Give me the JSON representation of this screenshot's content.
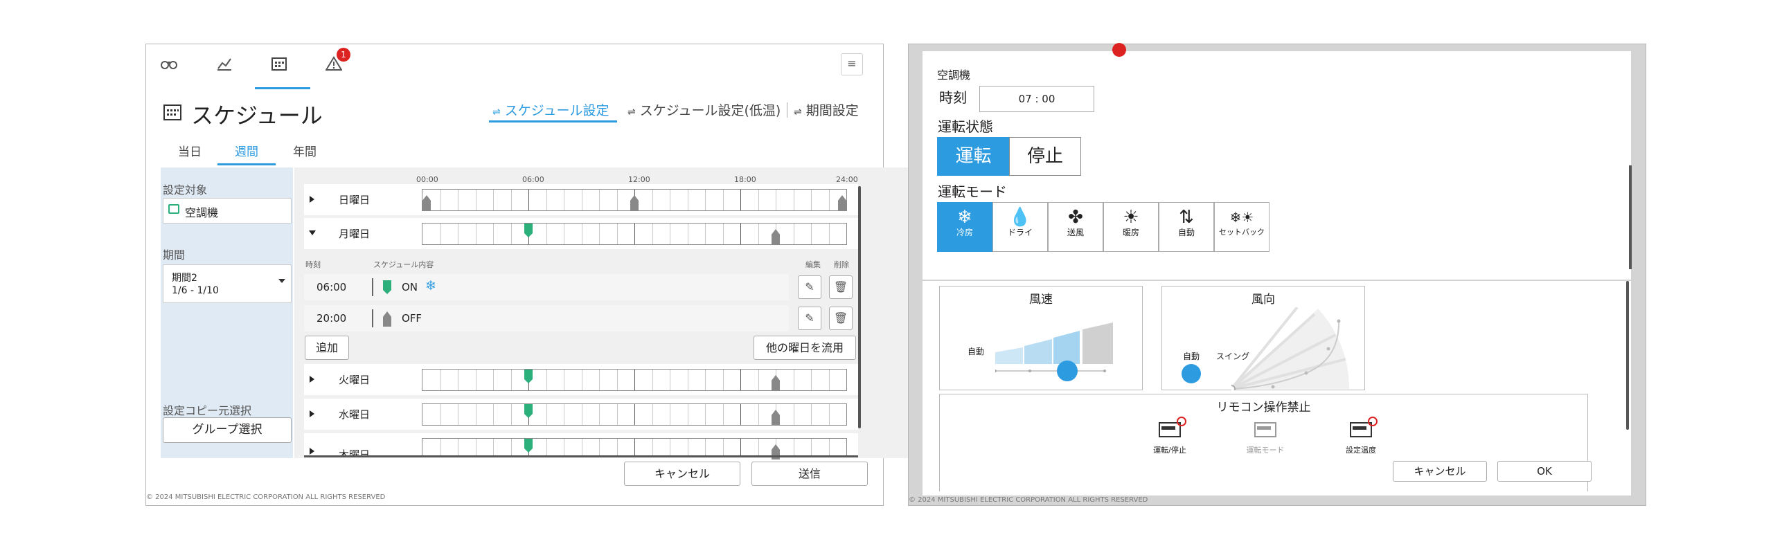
{
  "copyright": "© 2024 MITSUBISHI ELECTRIC CORPORATION ALL RIGHTS RESERVED",
  "left": {
    "nav": {
      "alert_count": "1"
    },
    "menu_icon": "≡",
    "page_title": "スケジュール",
    "settings_tabs": [
      "スケジュール設定",
      "スケジュール設定(低温)",
      "期間設定"
    ],
    "sub_tabs": [
      "当日",
      "週間",
      "年間"
    ],
    "sidebar": {
      "target_label": "設定対象",
      "target_value": "空調機",
      "period_label": "期間",
      "period_name": "期間2",
      "period_range": "1/6 - 1/10",
      "copy_label": "設定コピー元選択",
      "group_button": "グループ選択"
    },
    "time_axis": [
      "00:00",
      "06:00",
      "12:00",
      "18:00",
      "24:00"
    ],
    "days": [
      "日曜日",
      "月曜日",
      "火曜日",
      "水曜日",
      "木曜日"
    ],
    "detail_headers": {
      "time": "時刻",
      "content": "スケジュール内容",
      "edit": "編集",
      "delete": "削除"
    },
    "entries": [
      {
        "time": "06:00",
        "state": "ON"
      },
      {
        "time": "20:00",
        "state": "OFF"
      }
    ],
    "add_button": "追加",
    "copy_day_button": "他の曜日を流用",
    "cancel_button": "キャンセル",
    "send_button": "送信",
    "accent": "#2d9be0",
    "on_color": "#2bb07c"
  },
  "right": {
    "device_label": "空調機",
    "time_label": "時刻",
    "time_value": "07 : 00",
    "run_state_label": "運転状態",
    "run_on": "運転",
    "run_off": "停止",
    "mode_label": "運転モード",
    "modes": [
      {
        "label": "冷房",
        "icon": "snowflake-icon"
      },
      {
        "label": "ドライ",
        "icon": "droplet-icon"
      },
      {
        "label": "送風",
        "icon": "fan-icon"
      },
      {
        "label": "暖房",
        "icon": "sun-icon"
      },
      {
        "label": "自動",
        "icon": "auto-icon"
      },
      {
        "label": "セットバック",
        "icon": "setback-icon"
      }
    ],
    "fan_speed_title": "風速",
    "fan_speed_auto": "自動",
    "air_dir_title": "風向",
    "air_dir_auto": "自動",
    "air_dir_swing": "スイング",
    "prohibit_title": "リモコン操作禁止",
    "prohibit_items": [
      "運転/停止",
      "運転モード",
      "設定温度"
    ],
    "cancel_button": "キャンセル",
    "ok_button": "OK"
  }
}
